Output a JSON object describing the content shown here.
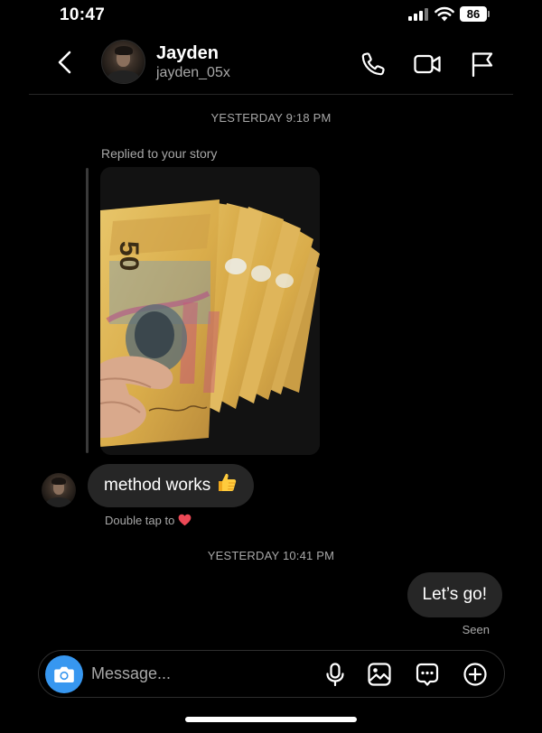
{
  "status_bar": {
    "time": "10:47",
    "battery": "86"
  },
  "header": {
    "name": "Jayden",
    "username": "jayden_05x"
  },
  "colors": {
    "background": "#000000",
    "bubble": "#262626",
    "accent": "#3797f0",
    "secondary_text": "#a8a8a8"
  },
  "icons": {
    "back": "chevron-left-icon",
    "call": "phone-icon",
    "video": "video-camera-icon",
    "report": "flag-icon",
    "camera": "camera-icon",
    "voice": "microphone-icon",
    "gallery": "image-icon",
    "sticker": "chat-bubble-dots-icon",
    "more": "plus-circle-icon"
  },
  "conversation": {
    "timestamp_1": "YESTERDAY 9:18 PM",
    "story_reply_label": "Replied to your story",
    "story_note_value": "50",
    "received_message": "method works",
    "received_emoji": "thumbs-up",
    "double_tap_hint": "Double tap to",
    "double_tap_emoji": "heart",
    "timestamp_2": "YESTERDAY 10:41 PM",
    "sent_message": "Let’s go!",
    "sent_status": "Seen"
  },
  "composer": {
    "placeholder": "Message..."
  }
}
